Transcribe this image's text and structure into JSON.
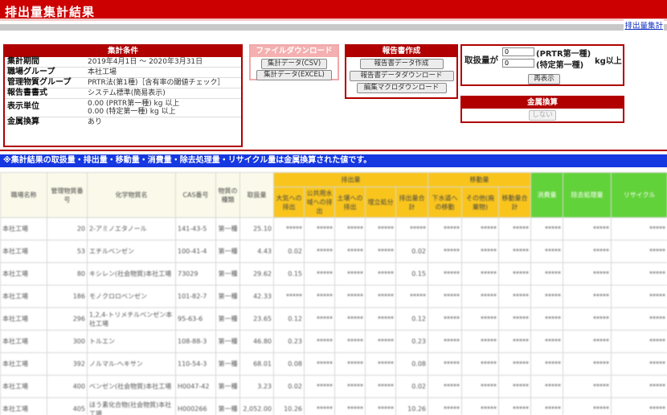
{
  "title": "排出量集計結果",
  "top_link": "排出量集計",
  "conditions": {
    "header": "集計条件",
    "rows": [
      {
        "key": "集計期間",
        "value": "2019年4月1日 〜 2020年3月31日"
      },
      {
        "key": "職場グループ",
        "value": "本社工場"
      },
      {
        "key": "管理物質グループ",
        "value": "PRTR法(第1種)［含有率の閾値チェック］"
      },
      {
        "key": "報告書書式",
        "value": "システム標準(簡易表示)"
      },
      {
        "key": "表示単位",
        "value": "0.00 (PRTR第一種) kg 以上",
        "value2": "0.00 (特定第一種) kg 以上"
      },
      {
        "key": "金属換算",
        "value": "あり"
      }
    ]
  },
  "download": {
    "header": "ファイルダウンロード",
    "csv": "集計データ(CSV)",
    "excel": "集計データ(EXCEL)"
  },
  "report": {
    "header": "報告書作成",
    "create": "報告書データ作成",
    "download": "報告書データダウンロード",
    "macro": "編集マクロダウンロード"
  },
  "amount": {
    "label": "取扱量が",
    "field1_value": "0",
    "field1_note": "(PRTR第一種)",
    "field2_value": "0",
    "field2_note": "(特定第一種)",
    "unit": "kg以上",
    "redisplay": "再表示"
  },
  "metal": {
    "header": "金属換算",
    "button": "しない"
  },
  "note": "※集計結果の取扱量・排出量・移動量・消費量・除去処理量・リサイクル量は金属換算された値です。",
  "table": {
    "headers": {
      "workplace": "職場名称",
      "substance_no": "管理物質番号",
      "chemical": "化学物質名",
      "cas": "CAS番号",
      "kind": "物質の種類",
      "handling": "取扱量",
      "emission": "排出量",
      "transfer": "移動量",
      "air": "大気への排出",
      "water": "公共用水域への排出",
      "soil": "土壌への排出",
      "landfill": "埋立処分",
      "emission_total": "排出量合計",
      "sewer": "下水道への移動",
      "other": "その他(廃棄物)",
      "transfer_total": "移動量合計",
      "consumption": "消費量",
      "removal": "除去処理量",
      "recycle": "リサイクル"
    },
    "rows": [
      {
        "workplace": "本社工場",
        "no": "20",
        "chem": "2-アミノエタノール",
        "cas": "141-43-5",
        "kind": "第一種",
        "handling": "25.10",
        "air": "*****",
        "water": "*****",
        "soil": "*****",
        "landfill": "*****",
        "etotal": "*****",
        "sewer": "*****",
        "other": "*****",
        "ttotal": "*****",
        "cons": "*****",
        "rem": "*****",
        "rec": "*****"
      },
      {
        "workplace": "本社工場",
        "no": "53",
        "chem": "エチルベンゼン",
        "cas": "100-41-4",
        "kind": "第一種",
        "handling": "4.43",
        "air": "0.02",
        "water": "*****",
        "soil": "*****",
        "landfill": "*****",
        "etotal": "0.02",
        "sewer": "*****",
        "other": "*****",
        "ttotal": "*****",
        "cons": "*****",
        "rem": "*****",
        "rec": "*****"
      },
      {
        "workplace": "本社工場",
        "no": "80",
        "chem": "キシレン(社会物質)本社工場",
        "cas": "73029",
        "kind": "第一種",
        "handling": "29.62",
        "air": "0.15",
        "water": "*****",
        "soil": "*****",
        "landfill": "*****",
        "etotal": "0.15",
        "sewer": "*****",
        "other": "*****",
        "ttotal": "*****",
        "cons": "*****",
        "rem": "*****",
        "rec": "*****"
      },
      {
        "workplace": "本社工場",
        "no": "186",
        "chem": "モノクロロベンゼン",
        "cas": "101-82-7",
        "kind": "第一種",
        "handling": "42.33",
        "air": "*****",
        "water": "*****",
        "soil": "*****",
        "landfill": "*****",
        "etotal": "*****",
        "sewer": "*****",
        "other": "*****",
        "ttotal": "*****",
        "cons": "*****",
        "rem": "*****",
        "rec": "*****"
      },
      {
        "workplace": "本社工場",
        "no": "296",
        "chem": "1,2,4-トリメチルベンゼン本社工場",
        "cas": "95-63-6",
        "kind": "第一種",
        "handling": "23.65",
        "air": "0.12",
        "water": "*****",
        "soil": "*****",
        "landfill": "*****",
        "etotal": "0.12",
        "sewer": "*****",
        "other": "*****",
        "ttotal": "*****",
        "cons": "*****",
        "rem": "*****",
        "rec": "*****"
      },
      {
        "workplace": "本社工場",
        "no": "300",
        "chem": "トルエン",
        "cas": "108-88-3",
        "kind": "第一種",
        "handling": "46.80",
        "air": "0.23",
        "water": "*****",
        "soil": "*****",
        "landfill": "*****",
        "etotal": "0.23",
        "sewer": "*****",
        "other": "*****",
        "ttotal": "*****",
        "cons": "*****",
        "rem": "*****",
        "rec": "*****"
      },
      {
        "workplace": "本社工場",
        "no": "392",
        "chem": "ノルマル-ヘキサン",
        "cas": "110-54-3",
        "kind": "第一種",
        "handling": "68.01",
        "air": "0.08",
        "water": "*****",
        "soil": "*****",
        "landfill": "*****",
        "etotal": "0.08",
        "sewer": "*****",
        "other": "*****",
        "ttotal": "*****",
        "cons": "*****",
        "rem": "*****",
        "rec": "*****"
      },
      {
        "workplace": "本社工場",
        "no": "400",
        "chem": "ベンゼン(社会物質)本社工場",
        "cas": "H0047-42",
        "kind": "第一種",
        "handling": "3.23",
        "air": "0.02",
        "water": "*****",
        "soil": "*****",
        "landfill": "*****",
        "etotal": "0.02",
        "sewer": "*****",
        "other": "*****",
        "ttotal": "*****",
        "cons": "*****",
        "rem": "*****",
        "rec": "*****"
      },
      {
        "workplace": "本社工場",
        "no": "405",
        "chem": "ほう素化合物(社会物質)本社工場",
        "cas": "H000266",
        "kind": "第一種",
        "handling": "2,052.00",
        "air": "10.26",
        "water": "*****",
        "soil": "*****",
        "landfill": "*****",
        "etotal": "10.26",
        "sewer": "*****",
        "other": "*****",
        "ttotal": "*****",
        "cons": "*****",
        "rem": "*****",
        "rec": "*****"
      }
    ]
  }
}
